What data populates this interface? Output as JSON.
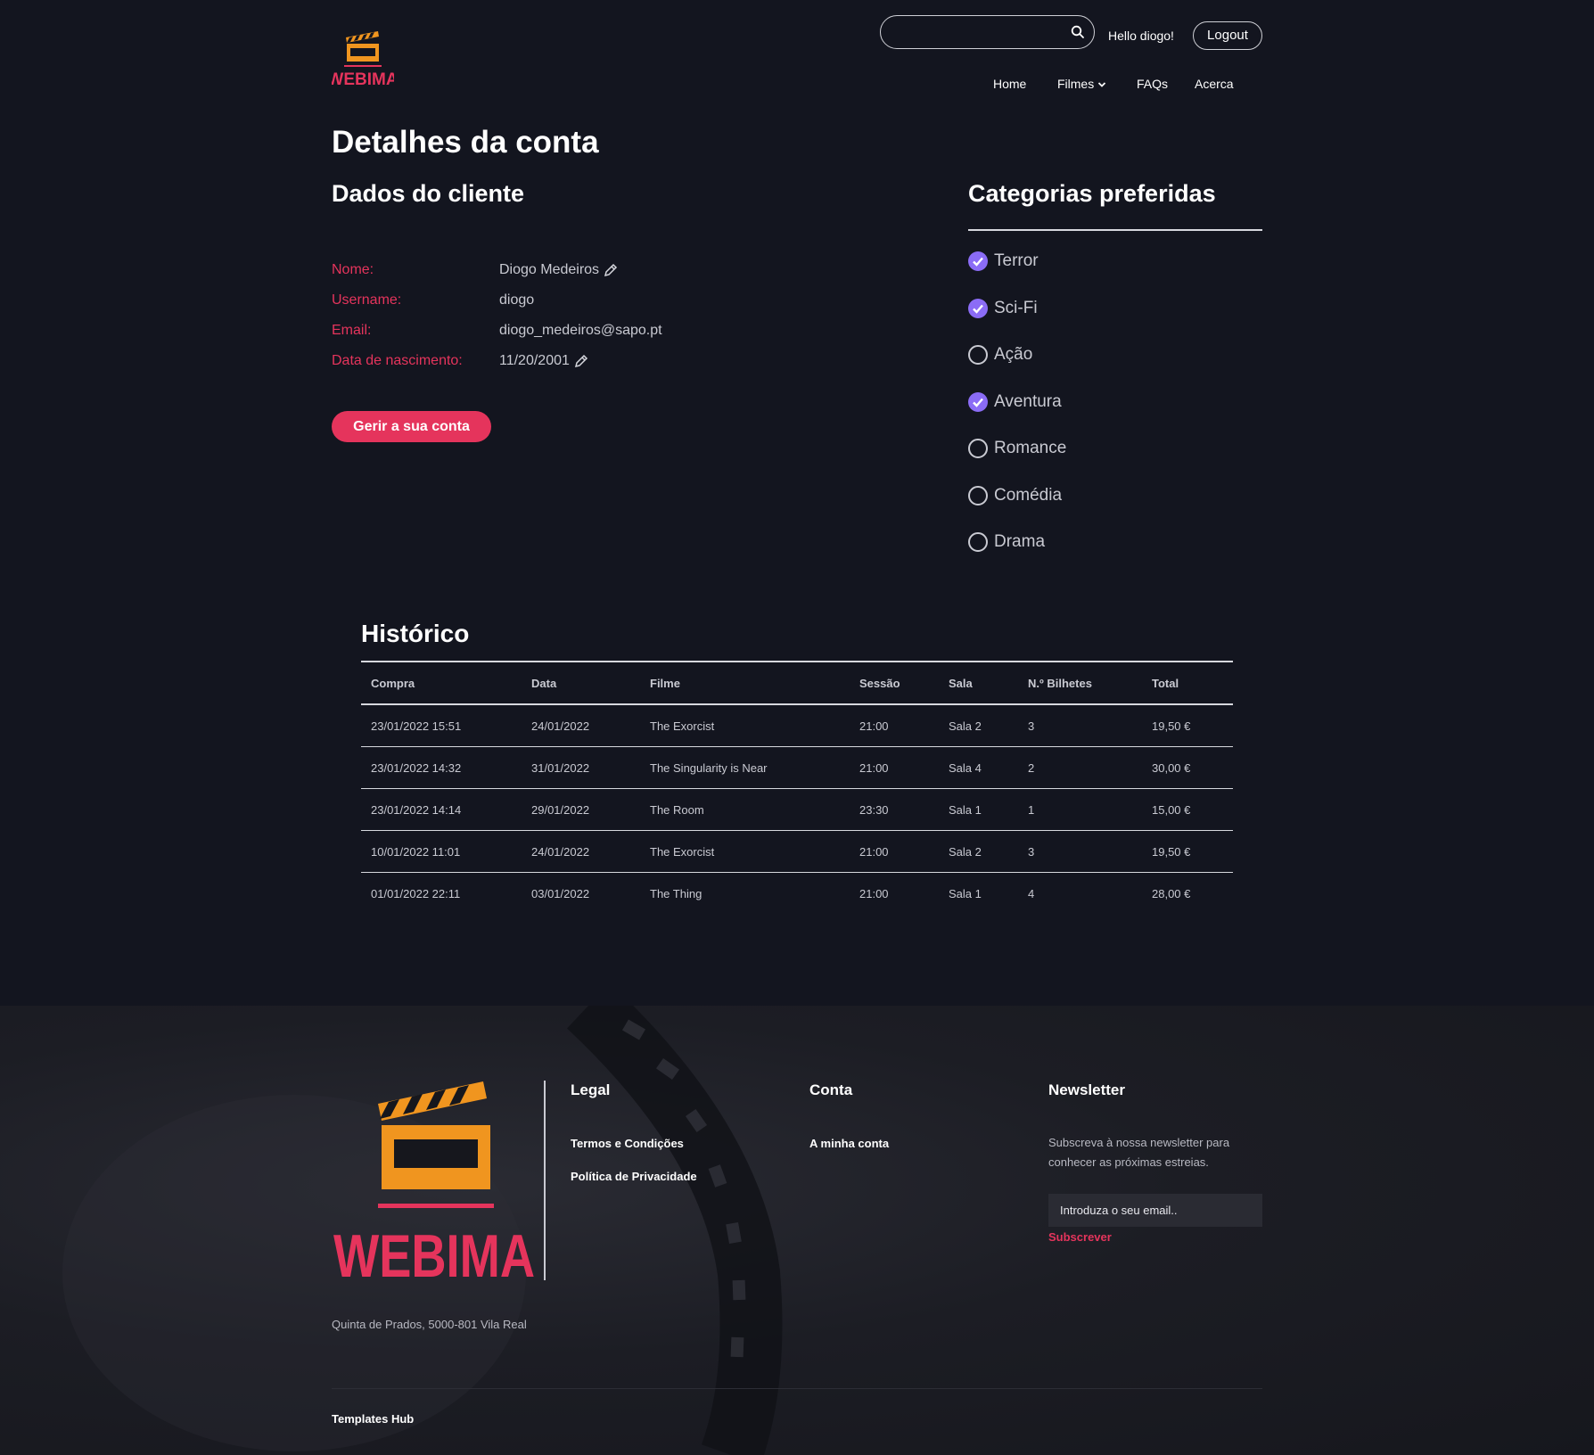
{
  "colors": {
    "accent": "#e5345c",
    "brand_orange": "#f0951f",
    "check_purple": "#8b6cf6",
    "background": "#13151f"
  },
  "header": {
    "logo_text": "WEBIMA",
    "search": {
      "placeholder": "",
      "value": "",
      "icon": "search-icon"
    },
    "greeting": "Hello diogo!",
    "logout_label": "Logout",
    "nav": {
      "home": "Home",
      "filmes": "Filmes",
      "faqs": "FAQs",
      "acerca": "Acerca"
    }
  },
  "page_title": "Detalhes da conta",
  "client": {
    "title": "Dados do cliente",
    "fields": [
      {
        "label": "Nome:",
        "value": "Diogo Medeiros",
        "editable": true
      },
      {
        "label": "Username:",
        "value": "diogo",
        "editable": false
      },
      {
        "label": "Email:",
        "value": "diogo_medeiros@sapo.pt",
        "editable": false
      },
      {
        "label": "Data de nascimento:",
        "value": "11/20/2001",
        "editable": true
      }
    ],
    "manage_button": "Gerir a sua conta"
  },
  "categories": {
    "title": "Categorias preferidas",
    "items": [
      {
        "label": "Terror",
        "checked": true
      },
      {
        "label": "Sci-Fi",
        "checked": true
      },
      {
        "label": "Ação",
        "checked": false
      },
      {
        "label": "Aventura",
        "checked": true
      },
      {
        "label": "Romance",
        "checked": false
      },
      {
        "label": "Comédia",
        "checked": false
      },
      {
        "label": "Drama",
        "checked": false
      }
    ]
  },
  "history": {
    "title": "Histórico",
    "columns": [
      "Compra",
      "Data",
      "Filme",
      "Sessão",
      "Sala",
      "N.º Bilhetes",
      "Total"
    ],
    "rows": [
      [
        "23/01/2022 15:51",
        "24/01/2022",
        "The Exorcist",
        "21:00",
        "Sala 2",
        "3",
        "19,50 €"
      ],
      [
        "23/01/2022 14:32",
        "31/01/2022",
        "The Singularity is Near",
        "21:00",
        "Sala 4",
        "2",
        "30,00 €"
      ],
      [
        "23/01/2022 14:14",
        "29/01/2022",
        "The Room",
        "23:30",
        "Sala 1",
        "1",
        "15,00 €"
      ],
      [
        "10/01/2022 11:01",
        "24/01/2022",
        "The Exorcist",
        "21:00",
        "Sala 2",
        "3",
        "19,50 €"
      ],
      [
        "01/01/2022 22:11",
        "03/01/2022",
        "The Thing",
        "21:00",
        "Sala 1",
        "4",
        "28,00 €"
      ]
    ]
  },
  "footer": {
    "logo_text": "WEBIMA",
    "address": "Quinta de Prados, 5000-801 Vila Real",
    "legal": {
      "title": "Legal",
      "links": [
        "Termos e Condições",
        "Política de Privacidade"
      ]
    },
    "conta": {
      "title": "Conta",
      "links": [
        "A minha conta"
      ]
    },
    "newsletter": {
      "title": "Newsletter",
      "text": "Subscreva à nossa newsletter para conhecer as próximas estreias.",
      "placeholder": "Introduza o seu email..",
      "button": "Subscrever"
    },
    "credit": "Templates Hub"
  }
}
